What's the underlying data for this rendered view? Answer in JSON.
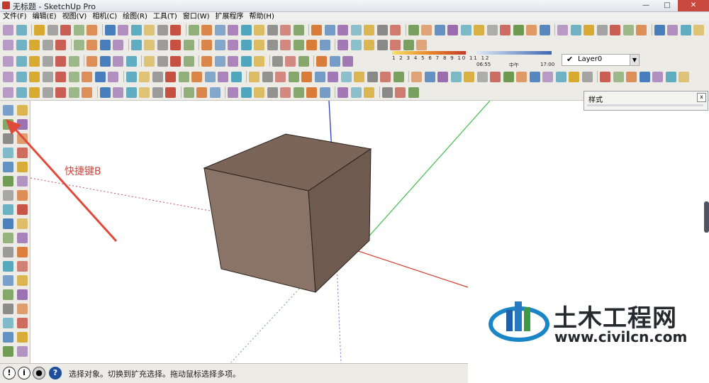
{
  "window": {
    "title": "无标题 - SketchUp Pro",
    "min": "—",
    "max": "□",
    "close": "✕"
  },
  "menu": [
    "文件(F)",
    "编辑(E)",
    "视图(V)",
    "相机(C)",
    "绘图(R)",
    "工具(T)",
    "窗口(W)",
    "扩展程序",
    "帮助(H)"
  ],
  "toolbar": {
    "scale_numbers": "1 2 3 4 5 6 7 8 9 10 11 12",
    "time_start": "06:55",
    "time_mid": "中午",
    "time_end": "17:00",
    "layer_name": "Layer0",
    "layer_check": "✔",
    "icon_colors": [
      "#c0392b",
      "#2e6db4",
      "#d4a017",
      "#5b8c3a",
      "#8e5aa8",
      "#7a7a7a",
      "#d66a1f",
      "#3a9bb5"
    ]
  },
  "panel": {
    "title": "样式",
    "close": "x"
  },
  "annotation": "快捷键B",
  "status": {
    "text": "选择对象。切换到扩充选择。拖动鼠标选择多项。",
    "icon_info": "i"
  },
  "watermark": {
    "name": "土木工程网",
    "url": "www.civilcn.com"
  },
  "scene": {
    "cube_front_color": "#8a7467",
    "cube_right_color": "#6e5a4f",
    "cube_top_color": "#7a6558"
  }
}
